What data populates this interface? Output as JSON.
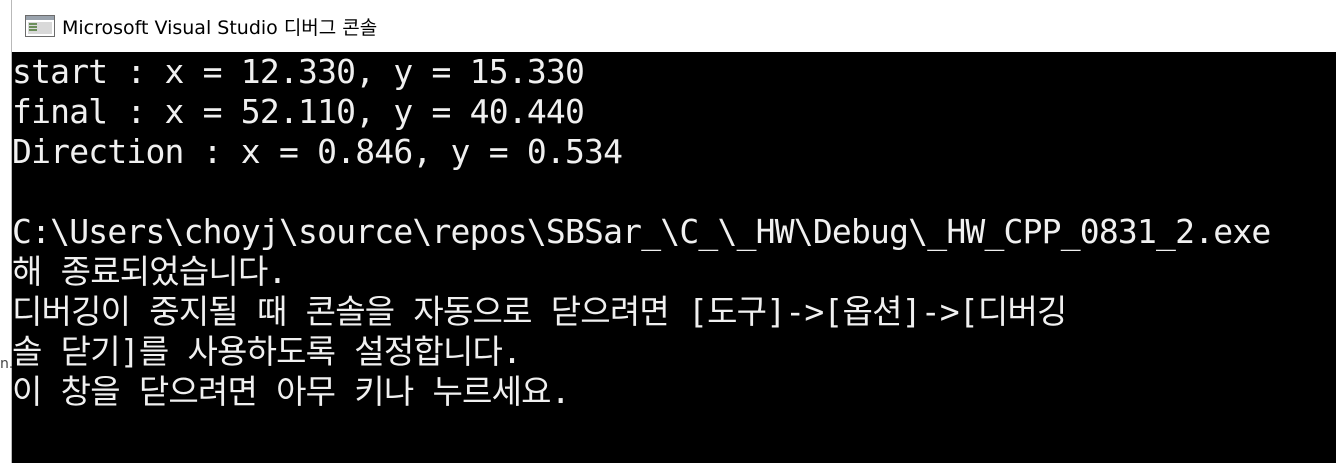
{
  "window": {
    "title": "Microsoft Visual Studio 디버그 콘솔",
    "icon": "console-app-icon"
  },
  "left_edge": {
    "fragment": "n."
  },
  "console": {
    "lines": [
      "start : x = 12.330, y = 15.330",
      "final : x = 52.110, y = 40.440",
      "Direction : x = 0.846, y = 0.534",
      "",
      "C:\\Users\\choyj\\source\\repos\\SBSar_\\C_\\_HW\\Debug\\_HW_CPP_0831_2.exe",
      "해 종료되었습니다.",
      "디버깅이 중지될 때 콘솔을 자동으로 닫으려면 [도구]->[옵션]->[디버깅",
      "솔 닫기]를 사용하도록 설정합니다.",
      "이 창을 닫으려면 아무 키나 누르세요."
    ]
  },
  "colors": {
    "console_bg": "#000000",
    "console_fg": "#f0f0f0",
    "titlebar_bg": "#ffffff"
  }
}
